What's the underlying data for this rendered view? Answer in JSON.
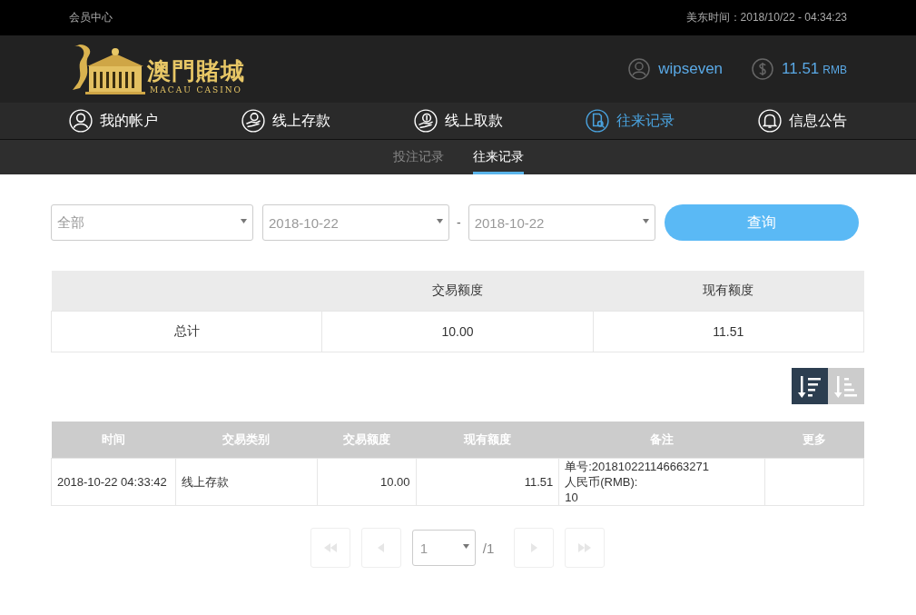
{
  "top_bar": {
    "title": "会员中心",
    "server_time": "美东时间：2018/10/22 - 04:34:23"
  },
  "header": {
    "logo_title": "澳門賭城",
    "logo_subtitle": "MACAU CASINO",
    "username": "wipseven",
    "balance": "11.51",
    "currency": "RMB"
  },
  "nav": {
    "items": [
      {
        "kind": "account",
        "label": "我的帐户",
        "selected": false
      },
      {
        "kind": "deposit",
        "label": "线上存款",
        "selected": false
      },
      {
        "kind": "withdraw",
        "label": "线上取款",
        "selected": false
      },
      {
        "kind": "records",
        "label": "往来记录",
        "selected": true
      },
      {
        "kind": "notice",
        "label": "信息公告",
        "selected": false
      }
    ]
  },
  "sub_tabs": [
    {
      "label": "投注记录",
      "selected": false
    },
    {
      "label": "往来记录",
      "selected": true
    }
  ],
  "filters": {
    "type": "全部",
    "date_from": "2018-10-22",
    "separator": "-",
    "date_to": "2018-10-22",
    "search_button": "查询"
  },
  "summary": {
    "columns": [
      "",
      "交易额度",
      "现有额度"
    ],
    "rows": [
      [
        "总计",
        "10.00",
        "11.51"
      ]
    ]
  },
  "sort_buttons": [
    {
      "kind": "descending",
      "selected": true
    },
    {
      "kind": "ascending",
      "selected": false
    }
  ],
  "records": {
    "columns": [
      "时间",
      "交易类别",
      "交易额度",
      "现有额度",
      "备注",
      "更多"
    ],
    "rows": [
      {
        "time": "2018-10-22 04:33:42",
        "type": "线上存款",
        "amount": "10.00",
        "balance": "11.51",
        "note": "单号:201810221146663271\n人民币(RMB):\n10"
      }
    ]
  },
  "pagination": {
    "page": "1",
    "total": "/1",
    "buttons": [
      {
        "kind": "first",
        "disabled": true
      },
      {
        "kind": "previous",
        "disabled": true
      },
      {
        "kind": "next",
        "disabled": true
      },
      {
        "kind": "last",
        "disabled": true
      }
    ]
  }
}
